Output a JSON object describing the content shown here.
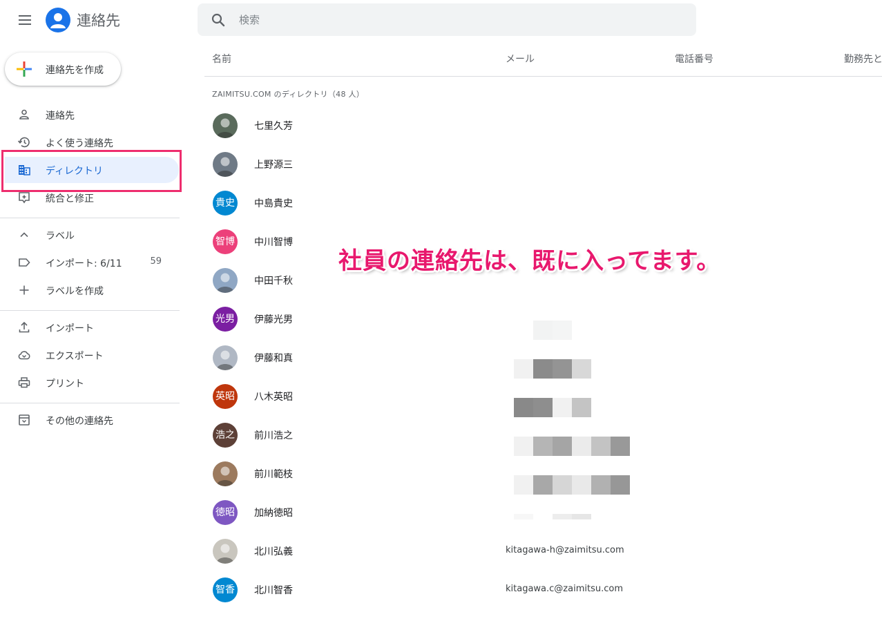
{
  "header": {
    "app_title": "連絡先",
    "search_placeholder": "検索"
  },
  "sidebar": {
    "create_label": "連絡先を作成",
    "items": [
      {
        "label": "連絡先",
        "icon": "person-icon"
      },
      {
        "label": "よく使う連絡先",
        "icon": "history-icon"
      },
      {
        "label": "ディレクトリ",
        "icon": "directory-icon",
        "active": true
      },
      {
        "label": "統合と修正",
        "icon": "merge-fix-icon"
      }
    ],
    "labels_header": "ラベル",
    "label_items": [
      {
        "label": "インポート: 6/11",
        "count": "59",
        "icon": "label-icon"
      }
    ],
    "create_label_item": "ラベルを作成",
    "tools": [
      {
        "label": "インポート",
        "icon": "upload-icon"
      },
      {
        "label": "エクスポート",
        "icon": "cloud-download-icon"
      },
      {
        "label": "プリント",
        "icon": "printer-icon"
      }
    ],
    "other_contacts": "その他の連絡先"
  },
  "table": {
    "headers": {
      "name": "名前",
      "email": "メール",
      "phone": "電話番号",
      "work": "勤務先と"
    },
    "directory_label": "ZAIMITSU.COM のディレクトリ（48 人）",
    "rows": [
      {
        "name": "七里久芳",
        "initials": "",
        "color": "#5a6b5c",
        "email": ""
      },
      {
        "name": "上野源三",
        "initials": "",
        "color": "#6f7a86",
        "email": ""
      },
      {
        "name": "中島貴史",
        "initials": "貴史",
        "color": "#0288d1",
        "email": ""
      },
      {
        "name": "中川智博",
        "initials": "智博",
        "color": "#ec407a",
        "email": ""
      },
      {
        "name": "中田千秋",
        "initials": "",
        "color": "#8fa7c4",
        "email": ""
      },
      {
        "name": "伊藤光男",
        "initials": "光男",
        "color": "#7b1fa2",
        "email": ""
      },
      {
        "name": "伊藤和真",
        "initials": "",
        "color": "#b0b8c4",
        "email": ""
      },
      {
        "name": "八木英昭",
        "initials": "英昭",
        "color": "#bf360c",
        "email": ""
      },
      {
        "name": "前川浩之",
        "initials": "浩之",
        "color": "#5d4037",
        "email": ""
      },
      {
        "name": "前川範枝",
        "initials": "",
        "color": "#9c7a5e",
        "email": ""
      },
      {
        "name": "加納徳昭",
        "initials": "徳昭",
        "color": "#7e57c2",
        "email": ""
      },
      {
        "name": "北川弘義",
        "initials": "",
        "color": "#c9c6be",
        "email": "kitagawa-h@zaimitsu.com"
      },
      {
        "name": "北川智香",
        "initials": "智香",
        "color": "#0288d1",
        "email": "kitagawa.c@zaimitsu.com"
      }
    ]
  },
  "annotation": "社員の連絡先は、既に入ってます。",
  "colors": {
    "accent": "#1a73e8",
    "active_bg": "#e8f0fe",
    "annotation": "#e8186d",
    "highlight_border": "#ee2d6e"
  }
}
